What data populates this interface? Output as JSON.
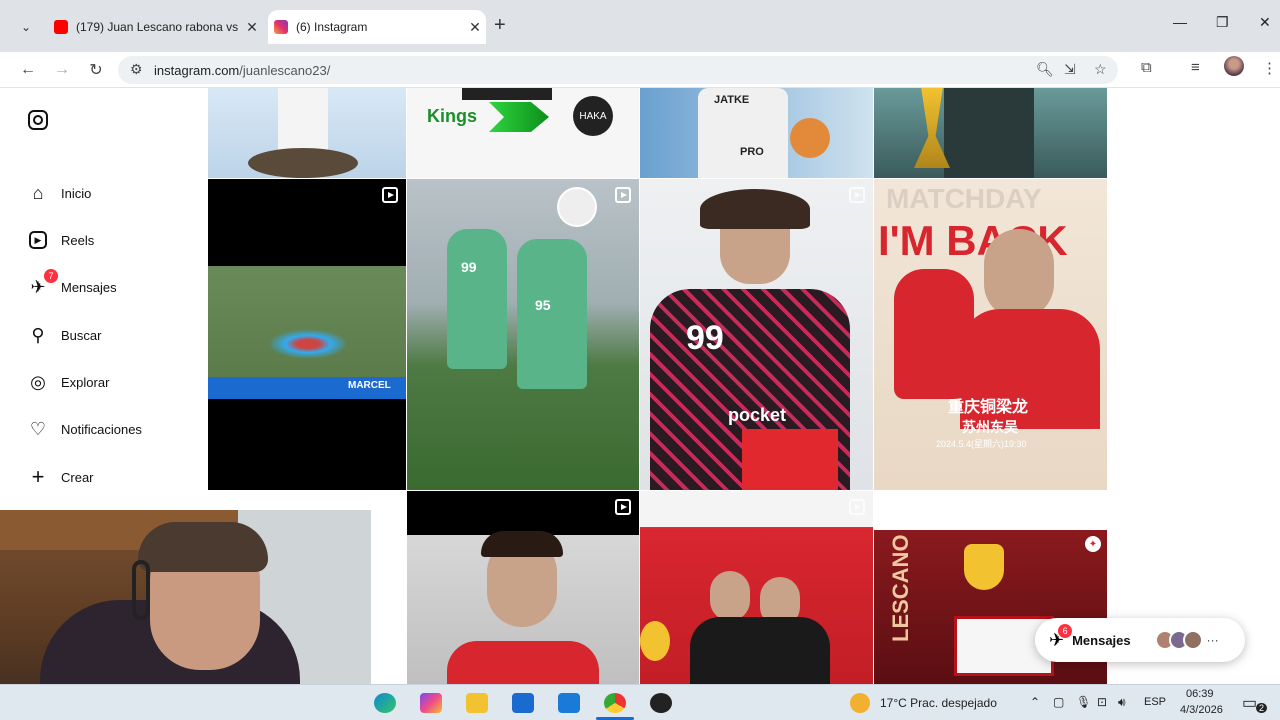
{
  "browser": {
    "tabs": [
      {
        "title": "(179) Juan Lescano rabona vs Z",
        "favicon": "youtube-icon",
        "active": false
      },
      {
        "title": "(6) Instagram",
        "favicon": "instagram-icon",
        "active": true
      }
    ],
    "url_host": "instagram.com",
    "url_path": "/juanlescano23/"
  },
  "sidebar": {
    "items": [
      {
        "label": "Inicio",
        "icon": "home-icon"
      },
      {
        "label": "Reels",
        "icon": "reels-icon"
      },
      {
        "label": "Mensajes",
        "icon": "messenger-icon",
        "badge": "7"
      },
      {
        "label": "Buscar",
        "icon": "search-icon"
      },
      {
        "label": "Explorar",
        "icon": "compass-icon"
      },
      {
        "label": "Notificaciones",
        "icon": "heart-icon"
      },
      {
        "label": "Crear",
        "icon": "plus-icon"
      }
    ]
  },
  "grid": {
    "post_texts": {
      "kings": "Kings",
      "haka": "HAKA",
      "jatke": "JATKE",
      "pro": "PRO",
      "marcel": "MARCEL",
      "jersey_number": "99",
      "jersey_number_2": "95",
      "pocket": "pocket",
      "matchday": "MATCHDAY",
      "im_back": "I'M BACK",
      "chinese_team": "重庆铜梁龙",
      "chinese_opponent": "苏州东吴",
      "match_date": "2024.5.4(星期六)19:30",
      "lescano": "LESCANO"
    }
  },
  "messages_pill": {
    "label": "Mensajes",
    "badge": "6"
  },
  "taskbar": {
    "weather": "17°C  Prac. despejado",
    "lang": "ESP",
    "time": "06:39",
    "date": "4/3/2026",
    "notif_count": "2"
  },
  "colors": {
    "accent": "#ff3040",
    "chrome": "#dfe3e8",
    "instagram_red": "#d8262f"
  }
}
